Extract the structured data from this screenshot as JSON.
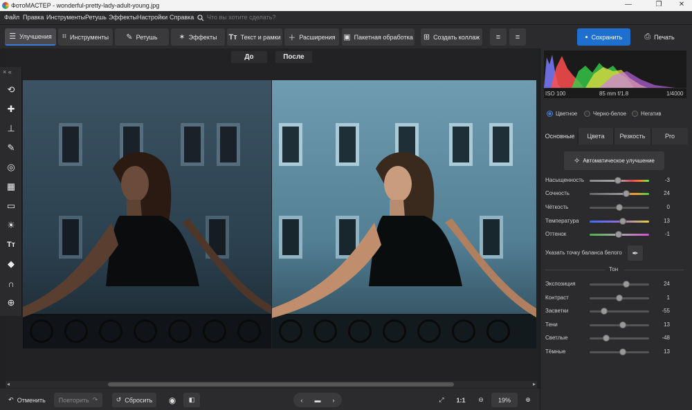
{
  "window": {
    "title": "ФотоМАСТЕР - wonderful-pretty-lady-adult-young.jpg"
  },
  "menu": {
    "items": [
      "Файл",
      "Правка",
      "Инструменты",
      "Ретушь",
      "Эффекты",
      "Настройки",
      "Справка"
    ],
    "search_placeholder": "Что вы хотите сделать?"
  },
  "toolbar": {
    "tabs": [
      "Улучшения",
      "Инструменты",
      "Ретушь",
      "Эффекты",
      "Текст и рамки",
      "Расширения"
    ],
    "batch": "Пакетная обработка",
    "collage": "Создать коллаж",
    "save": "Сохранить",
    "print": "Печать"
  },
  "compare": {
    "before": "До",
    "after": "После"
  },
  "histogram": {
    "iso": "ISO 100",
    "lens": "85 mm f/1.8",
    "shutter": "1/4000"
  },
  "color_modes": {
    "options": [
      "Цветное",
      "Черно-белое",
      "Негатив"
    ],
    "selected": "Цветное"
  },
  "adjust_tabs": [
    "Основные",
    "Цвета",
    "Резкость",
    "Pro"
  ],
  "auto_button": "Автоматическое улучшение",
  "sliders_top": [
    {
      "label": "Насыщенность",
      "value": -3,
      "frac": 0.48
    },
    {
      "label": "Сочность",
      "value": 24,
      "frac": 0.62
    },
    {
      "label": "Чёткость",
      "value": 0,
      "frac": 0.5
    },
    {
      "label": "Температура",
      "value": 13,
      "frac": 0.56
    },
    {
      "label": "Оттенок",
      "value": -1,
      "frac": 0.49
    }
  ],
  "white_balance_label": "Указать точку баланса белого",
  "tone_header": "Тон",
  "sliders_tone": [
    {
      "label": "Экспозиция",
      "value": 24,
      "frac": 0.62
    },
    {
      "label": "Контраст",
      "value": 1,
      "frac": 0.5
    },
    {
      "label": "Засветки",
      "value": -55,
      "frac": 0.24
    },
    {
      "label": "Тени",
      "value": 13,
      "frac": 0.56
    },
    {
      "label": "Светлые",
      "value": -48,
      "frac": 0.28
    },
    {
      "label": "Тёмные",
      "value": 13,
      "frac": 0.56
    }
  ],
  "bottom": {
    "undo": "Отменить",
    "redo": "Повторить",
    "reset": "Сбросить",
    "ratio": "1:1",
    "zoom": "19%"
  },
  "tools_header": "× «"
}
